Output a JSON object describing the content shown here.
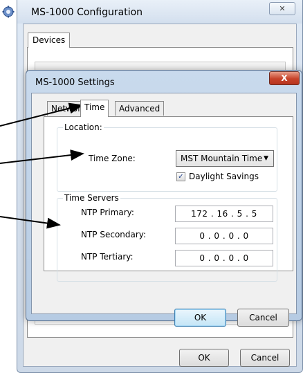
{
  "outer_window": {
    "title": "MS-1000 Configuration",
    "close_glyph": "✕",
    "tab_label": "Devices",
    "ok_label": "OK",
    "cancel_label": "Cancel"
  },
  "dialog": {
    "title": "MS-1000 Settings",
    "close_glyph": "X",
    "tabs": [
      {
        "label": "Network",
        "active": false
      },
      {
        "label": "Time",
        "active": true
      },
      {
        "label": "Advanced",
        "active": false
      }
    ],
    "location": {
      "legend": "Location:",
      "time_zone_label": "Time Zone:",
      "time_zone_value": "MST Mountain Time",
      "daylight_label": "Daylight Savings",
      "daylight_checked": true
    },
    "time_servers": {
      "legend": "Time Servers",
      "ntp_primary_label": "NTP Primary:",
      "ntp_primary_value": "172 .  16 .  5  .  5",
      "ntp_secondary_label": "NTP Secondary:",
      "ntp_secondary_value": "0  .  0  .  0  .  0",
      "ntp_tertiary_label": "NTP Tertiary:",
      "ntp_tertiary_value": "0  .  0  .  0  .  0"
    },
    "ok_label": "OK",
    "cancel_label": "Cancel"
  },
  "icons": {
    "app_icon": "gear-icon",
    "dropdown_arrow": "▼",
    "check_mark": "✓"
  },
  "colors": {
    "dialog_close": "#c7432a",
    "window_frame": "#c9daed",
    "ok_focus": "#3c7fb1"
  }
}
